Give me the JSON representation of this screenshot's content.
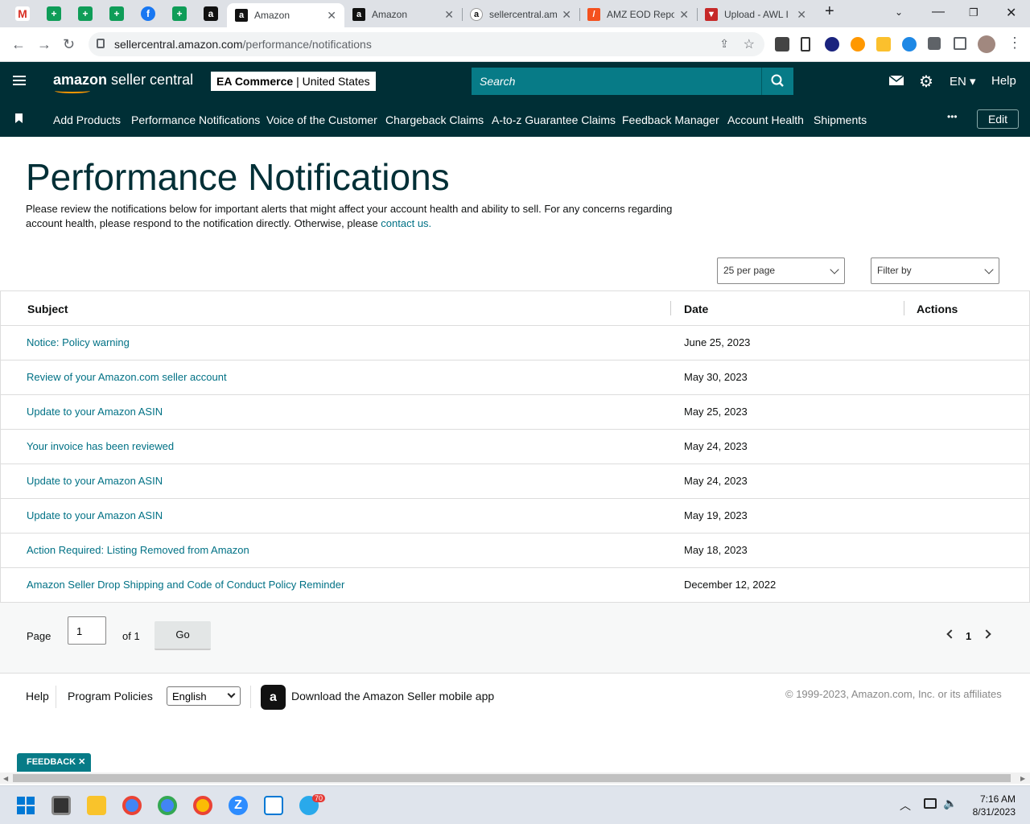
{
  "browser": {
    "tabs": [
      {
        "title": "Amazon",
        "active": true
      },
      {
        "title": "Amazon",
        "active": false
      },
      {
        "title": "sellercentral.am",
        "active": false
      },
      {
        "title": "AMZ EOD Repo",
        "active": false
      },
      {
        "title": "Upload - AWL I",
        "active": false
      }
    ],
    "url_host": "sellercentral.amazon.com",
    "url_path": "/performance/notifications"
  },
  "header": {
    "logo_brand": "amazon",
    "logo_product": "seller central",
    "account_name": "EA Commerce",
    "account_sep": " | ",
    "account_region": "United States",
    "search_placeholder": "Search",
    "language": "EN",
    "help": "Help"
  },
  "nav": {
    "items": [
      "Add Products",
      "Performance Notifications",
      "Voice of the Customer",
      "Chargeback Claims",
      "A-to-z Guarantee Claims",
      "Feedback Manager",
      "Account Health",
      "Shipments"
    ],
    "more": "•••",
    "edit": "Edit"
  },
  "page": {
    "title": "Performance Notifications",
    "description": "Please review the notifications below for important alerts that might affect your account health and ability to sell. For any concerns regarding account health, please respond to the notification directly. Otherwise, please ",
    "contact_link": "contact us.",
    "per_page": "25 per page",
    "filter": "Filter by"
  },
  "table": {
    "headers": {
      "subject": "Subject",
      "date": "Date",
      "actions": "Actions"
    },
    "rows": [
      {
        "subject": "Notice: Policy warning",
        "date": "June 25, 2023"
      },
      {
        "subject": "Review of your Amazon.com seller account",
        "date": "May 30, 2023"
      },
      {
        "subject": "Update to your Amazon ASIN",
        "date": "May 25, 2023"
      },
      {
        "subject": "Your invoice has been reviewed",
        "date": "May 24, 2023"
      },
      {
        "subject": "Update to your Amazon ASIN",
        "date": "May 24, 2023"
      },
      {
        "subject": "Update to your Amazon ASIN",
        "date": "May 19, 2023"
      },
      {
        "subject": "Action Required: Listing Removed from Amazon",
        "date": "May 18, 2023"
      },
      {
        "subject": "Amazon Seller Drop Shipping and Code of Conduct Policy Reminder",
        "date": "December 12, 2022"
      }
    ]
  },
  "pagination": {
    "page_label": "Page",
    "page_value": "1",
    "of_label": "of 1",
    "go": "Go",
    "current": "1"
  },
  "footer": {
    "help": "Help",
    "policies": "Program Policies",
    "language": "English",
    "app_text": "Download the Amazon Seller mobile app",
    "copyright": "© 1999-2023, Amazon.com, Inc. or its affiliates"
  },
  "feedback": "FEEDBACK ✕",
  "taskbar": {
    "time": "7:16 AM",
    "date": "8/31/2023",
    "telegram_badge": "70"
  },
  "colors": {
    "header_bg": "#002f36",
    "accent_teal": "#077b87",
    "link": "#007185"
  }
}
